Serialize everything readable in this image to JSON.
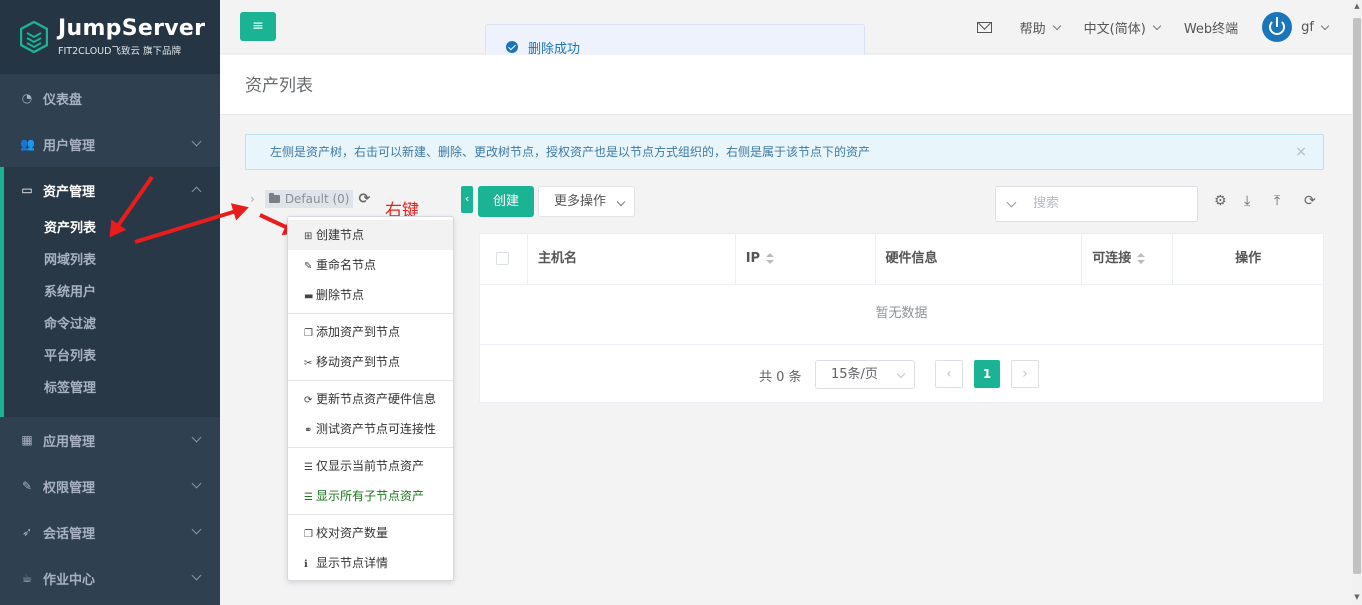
{
  "brand": {
    "title": "JumpServer",
    "subtitle": "FIT2CLOUD飞致云 旗下品牌"
  },
  "colors": {
    "accent": "#1ab394",
    "sidebar_bg": "#2f4050",
    "annotation_red": "#ea1d1d",
    "toast_blue": "#1b75bb"
  },
  "sidebar": {
    "items": [
      {
        "label": "仪表盘",
        "icon": "dashboard-icon"
      },
      {
        "label": "用户管理",
        "icon": "users-icon"
      },
      {
        "label": "资产管理",
        "icon": "inbox-icon",
        "active": true
      },
      {
        "label": "应用管理",
        "icon": "apps-grid-icon"
      },
      {
        "label": "权限管理",
        "icon": "edit-icon"
      },
      {
        "label": "会话管理",
        "icon": "rocket-icon"
      },
      {
        "label": "作业中心",
        "icon": "coffee-icon"
      }
    ],
    "asset_subitems": [
      "资产列表",
      "网域列表",
      "系统用户",
      "命令过滤",
      "平台列表",
      "标签管理"
    ]
  },
  "topbar": {
    "help": "帮助",
    "language": "中文(简体)",
    "web_terminal": "Web终端",
    "username": "gf"
  },
  "toast": {
    "message": "删除成功"
  },
  "page": {
    "title": "资产列表"
  },
  "alert": {
    "text": "左侧是资产树，右击可以新建、删除、更改树节点，授权资产也是以节点方式组织的，右侧是属于该节点下的资产",
    "close": "×"
  },
  "tree": {
    "root_label": "Default (0)"
  },
  "annotation": {
    "text": "右键"
  },
  "context_menu": {
    "group1": [
      "创建节点",
      "重命名节点",
      "删除节点"
    ],
    "group2": [
      "添加资产到节点",
      "移动资产到节点"
    ],
    "group3": [
      "更新节点资产硬件信息",
      "测试资产节点可连接性"
    ],
    "group4": [
      "仅显示当前节点资产",
      "显示所有子节点资产"
    ],
    "group5": [
      "校对资产数量",
      "显示节点详情"
    ]
  },
  "toolbar": {
    "create_label": "创建",
    "more_label": "更多操作",
    "search_placeholder": "搜索"
  },
  "table": {
    "columns": [
      "主机名",
      "IP",
      "硬件信息",
      "可连接",
      "操作"
    ],
    "empty_text": "暂无数据"
  },
  "pagination": {
    "total": "共 0 条",
    "page_size": "15条/页",
    "current_page": "1"
  }
}
